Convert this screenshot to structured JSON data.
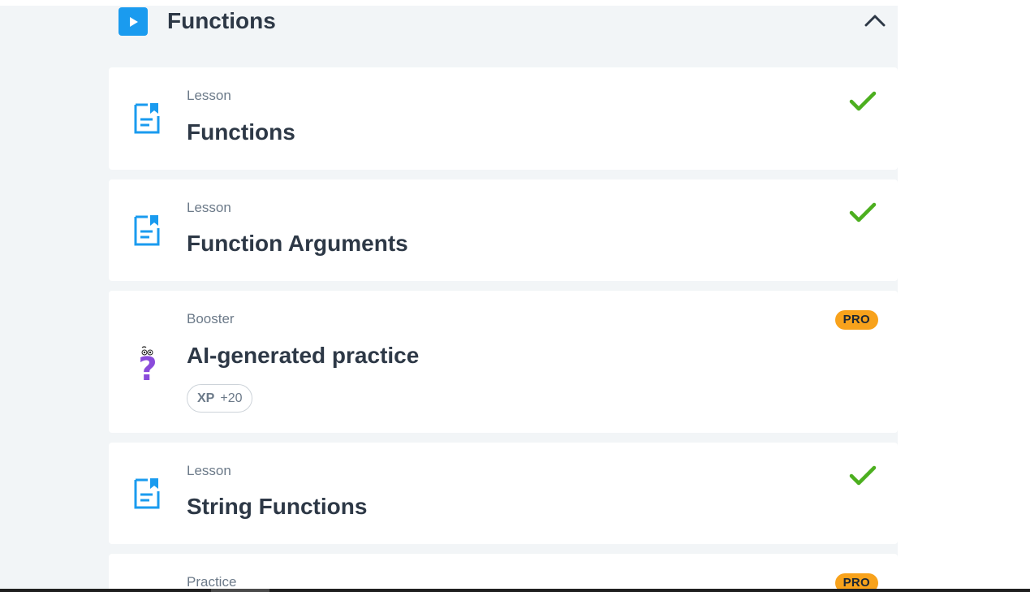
{
  "section": {
    "title": "Functions",
    "play_icon": "play-icon",
    "collapse_icon": "chevron-up-icon"
  },
  "cards": [
    {
      "type": "Lesson",
      "title": "Functions",
      "status": "completed",
      "icon": "lesson-document-icon"
    },
    {
      "type": "Lesson",
      "title": "Function Arguments",
      "status": "completed",
      "icon": "lesson-document-icon"
    },
    {
      "type": "Booster",
      "title": "AI-generated practice",
      "badge": "PRO",
      "xp_label": "XP",
      "xp_value": "+20",
      "icon": "question-mark-character-icon"
    },
    {
      "type": "Lesson",
      "title": "String Functions",
      "status": "completed",
      "icon": "lesson-document-icon"
    },
    {
      "type": "Practice",
      "badge": "PRO"
    }
  ],
  "colors": {
    "accent_blue": "#1a9bef",
    "check_green": "#4caf1f",
    "pro_orange": "#f8a21b",
    "booster_purple": "#8a4bdb",
    "page_bg": "#f2f5f7"
  }
}
